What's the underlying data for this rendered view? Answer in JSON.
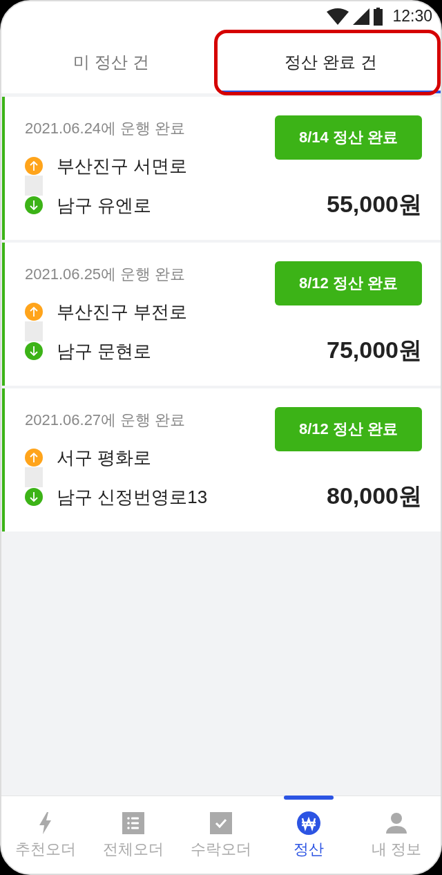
{
  "status_bar": {
    "time": "12:30"
  },
  "tabs": [
    {
      "label": "미 정산 건",
      "selected": false,
      "highlighted": false
    },
    {
      "label": "정산 완료 건",
      "selected": true,
      "highlighted": true
    }
  ],
  "orders": [
    {
      "completed": "2021.06.24에 운행 완료",
      "settlement": "8/14 정산 완료",
      "pickup": "부산진구 서면로",
      "dropoff": "남구 유엔로",
      "amount": "55,000원"
    },
    {
      "completed": "2021.06.25에 운행 완료",
      "settlement": "8/12 정산 완료",
      "pickup": "부산진구 부전로",
      "dropoff": "남구 문현로",
      "amount": "75,000원"
    },
    {
      "completed": "2021.06.27에 운행 완료",
      "settlement": "8/12 정산 완료",
      "pickup": "서구 평화로",
      "dropoff": "남구 신정번영로13",
      "amount": "80,000원"
    }
  ],
  "bottom_nav": [
    {
      "label": "추천오더",
      "kind": "bolt",
      "selected": false
    },
    {
      "label": "전체오더",
      "kind": "list",
      "selected": false
    },
    {
      "label": "수락오더",
      "kind": "check",
      "selected": false
    },
    {
      "label": "정산",
      "kind": "won",
      "selected": true
    },
    {
      "label": "내 정보",
      "kind": "person",
      "selected": false
    }
  ]
}
